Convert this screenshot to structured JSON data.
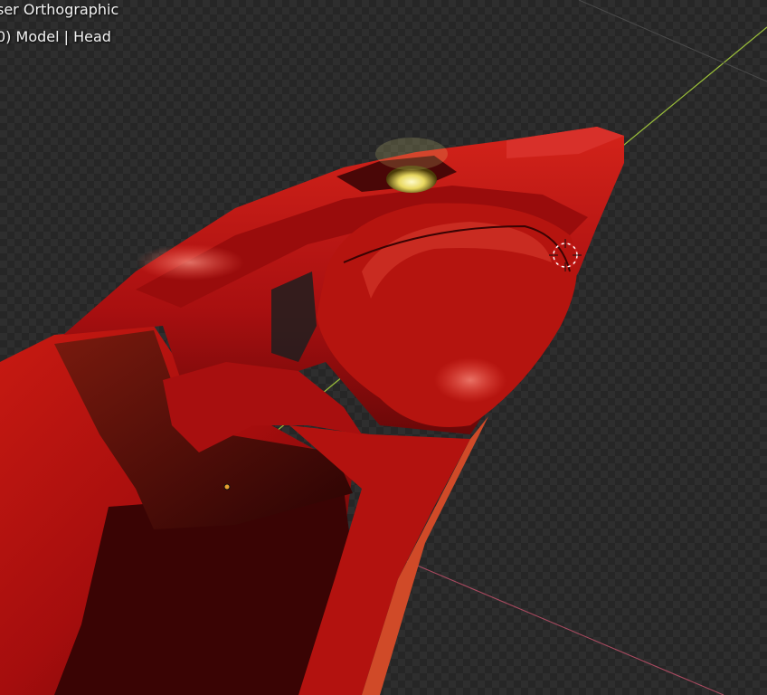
{
  "viewport": {
    "view_name": "ser Orthographic",
    "object_info": "0) Model | Head"
  },
  "colors": {
    "model_red": "#b01010",
    "model_dark": "#4a0606",
    "y_axis": "#9bbf3a",
    "x_axis": "#c0506a",
    "eye_glow": "#f4f08a"
  },
  "icons": {
    "cursor": "3d-cursor-icon",
    "origin": "object-origin-icon"
  }
}
